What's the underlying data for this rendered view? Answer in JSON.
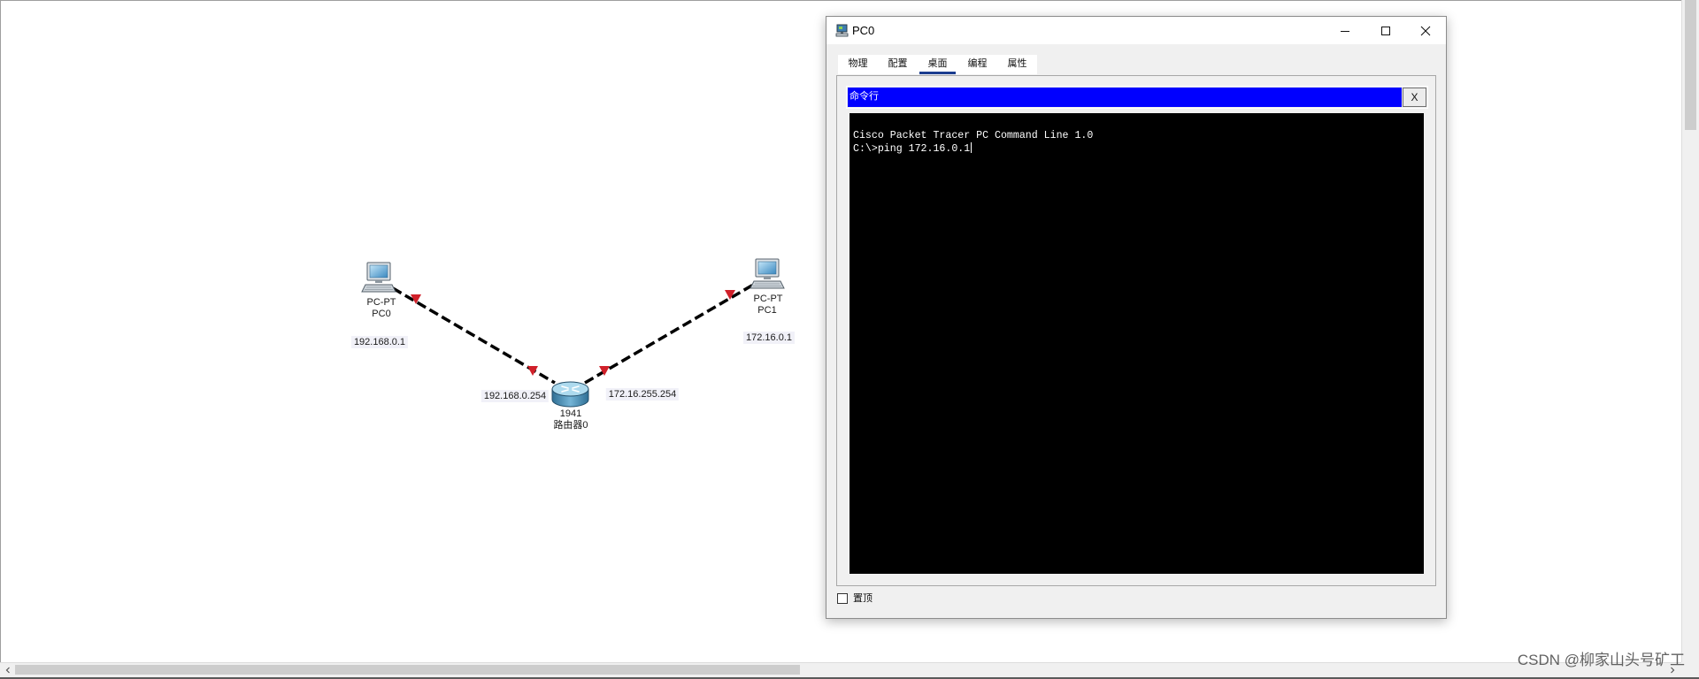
{
  "workspace": {
    "devices": {
      "pc0": {
        "model": "PC-PT",
        "name": "PC0",
        "ip": "192.168.0.1",
        "icon": "pc-icon"
      },
      "pc1": {
        "model": "PC-PT",
        "name": "PC1",
        "ip": "172.16.0.1",
        "icon": "pc-icon"
      },
      "router0": {
        "model": "1941",
        "name": "路由器0",
        "icon": "router-icon"
      }
    },
    "interface_labels": {
      "router_to_pc0": "192.168.0.254",
      "router_to_pc1": "172.16.255.254"
    }
  },
  "pc_window": {
    "title": "PC0",
    "title_icon": "pc-icon",
    "controls": {
      "minimize": "minimize-icon",
      "maximize": "maximize-icon",
      "close": "close-icon"
    },
    "tabs": [
      {
        "label": "物理",
        "selected": false
      },
      {
        "label": "配置",
        "selected": false
      },
      {
        "label": "桌面",
        "selected": true
      },
      {
        "label": "编程",
        "selected": false
      },
      {
        "label": "属性",
        "selected": false
      }
    ],
    "app": {
      "title": "命令行",
      "close_label": "X",
      "terminal": {
        "lines": [
          "Cisco Packet Tracer PC Command Line 1.0",
          "C:\\>ping 172.16.0.1"
        ]
      }
    },
    "always_on_top": {
      "label": "置顶",
      "checked": false
    }
  },
  "watermark": "CSDN @柳家山头号矿工",
  "colors": {
    "app_title_bar": "#0000ff",
    "terminal_background": "#000000",
    "terminal_text": "#ffffff",
    "link_line": "#000000",
    "link_status_down": "#d0202a",
    "selected_tab_indicator": "#1b3d8f",
    "window_background": "#f0f0f0"
  }
}
